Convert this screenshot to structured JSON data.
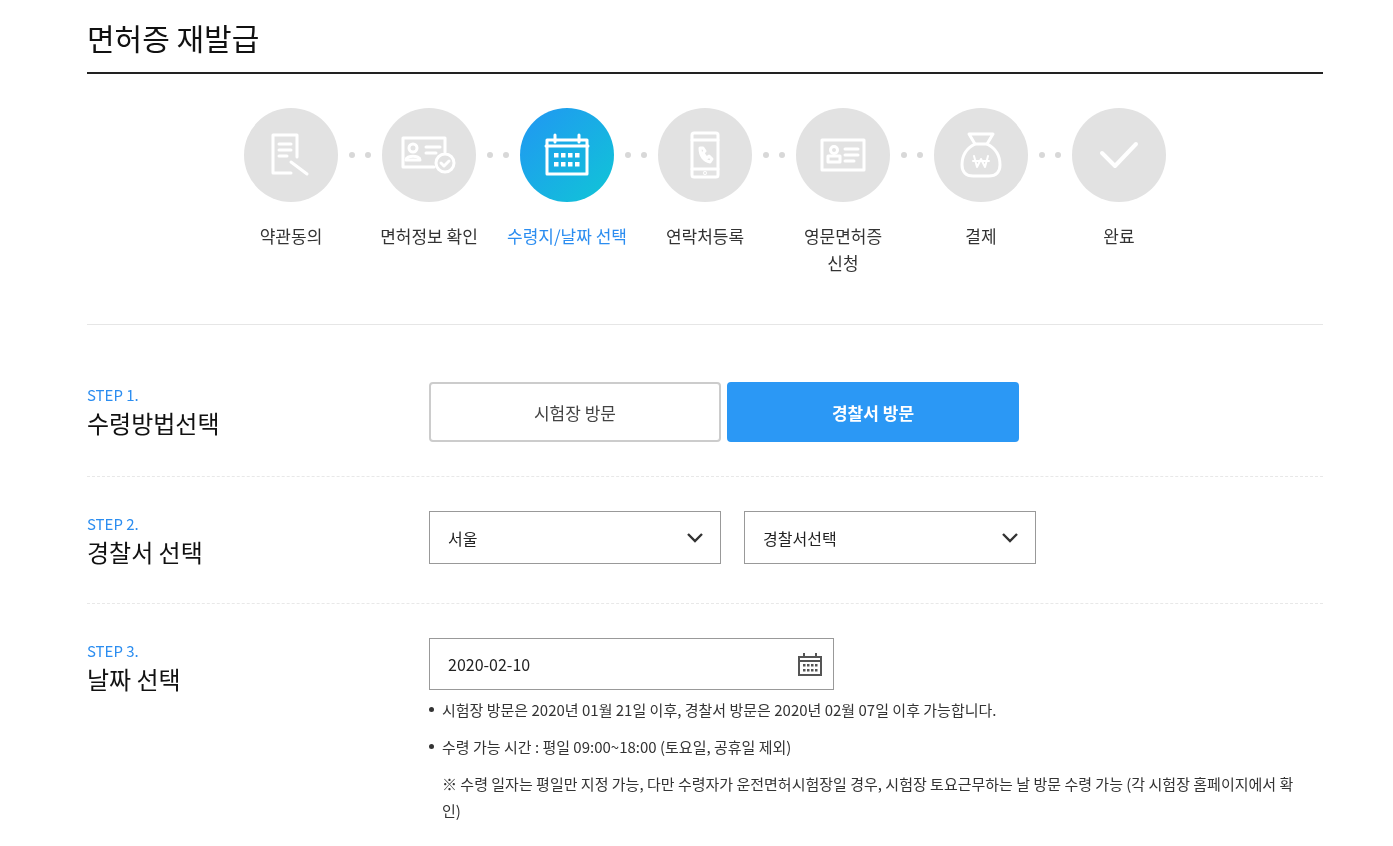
{
  "page_title": "면허증 재발급",
  "progress_steps": [
    {
      "label": "약관동의",
      "kind": "document",
      "selected": false
    },
    {
      "label": "면허정보 확인",
      "kind": "idcheck",
      "selected": false
    },
    {
      "label": "수령지/날짜 선택",
      "kind": "calendar",
      "selected": true
    },
    {
      "label": "연락처등록",
      "kind": "phone",
      "selected": false
    },
    {
      "label": "영문면허증\n신청",
      "kind": "card",
      "selected": false
    },
    {
      "label": "결제",
      "kind": "money",
      "selected": false
    },
    {
      "label": "완료",
      "kind": "check",
      "selected": false
    }
  ],
  "sections": [
    {
      "step": "STEP 1.",
      "title": "수령방법선택",
      "kind": "choice",
      "options": [
        {
          "label": "시험장 방문",
          "selected": false
        },
        {
          "label": "경찰서 방문",
          "selected": true
        }
      ]
    },
    {
      "step": "STEP 2.",
      "title": "경찰서 선택",
      "kind": "selects",
      "selects": [
        {
          "value": "서울"
        },
        {
          "value": "경찰서선택"
        }
      ]
    },
    {
      "step": "STEP 3.",
      "title": "날짜 선택",
      "kind": "date",
      "value": "2020-02-10",
      "notes": [
        {
          "kind": "bullet",
          "text": "시험장 방문은 2020년 01월 21일 이후, 경찰서 방문은 2020년 02월 07일 이후 가능합니다."
        },
        {
          "kind": "bullet",
          "text": "수령 가능 시간 : 평일 09:00~18:00 (토요일, 공휴일 제외)"
        },
        {
          "kind": "remark",
          "text": "※ 수령 일자는 평일만 지정 가능, 다만 수령자가 운전면허시험장일 경우, 시험장 토요근무하는 날 방문 수령 가능 (각 시험장 홈페이지에서 확인)"
        }
      ]
    }
  ]
}
